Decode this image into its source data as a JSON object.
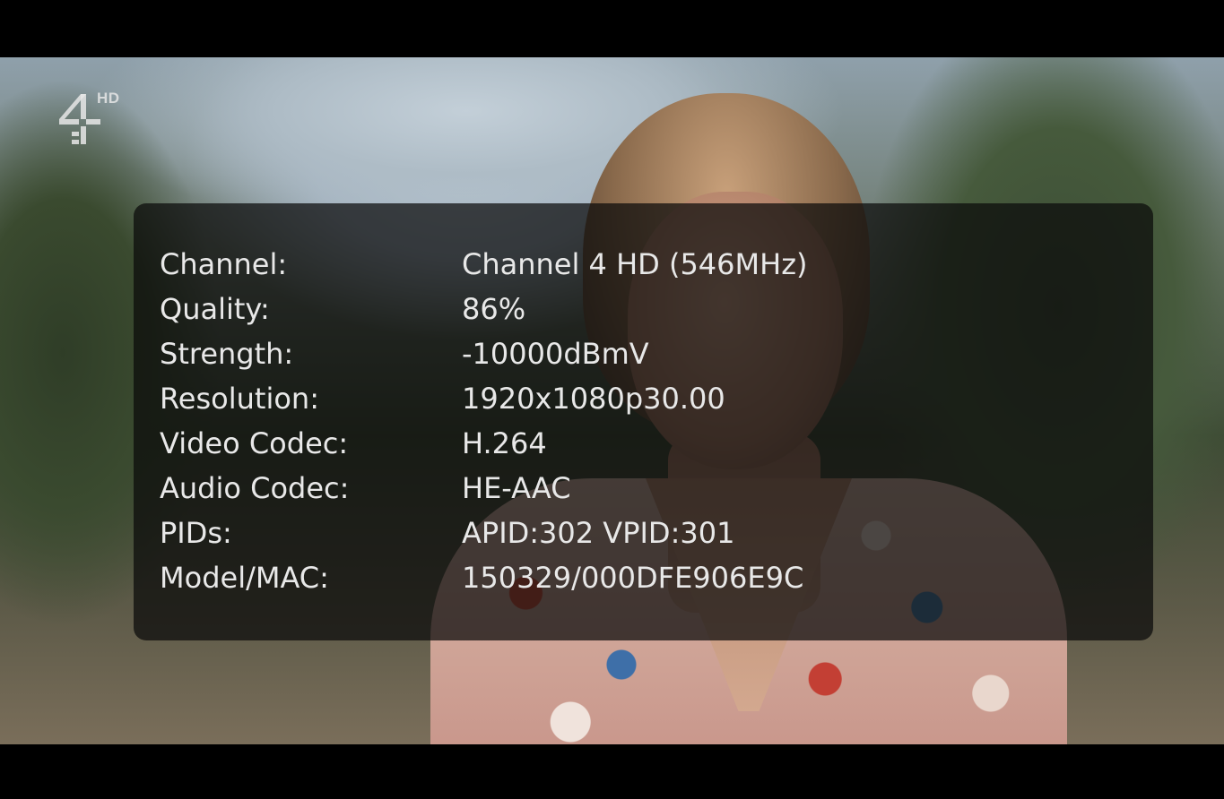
{
  "logo": {
    "icon": "channel-4-logo-icon",
    "badge": "HD"
  },
  "info": {
    "rows": [
      {
        "label": "Channel:",
        "value": "Channel 4 HD (546MHz)"
      },
      {
        "label": "Quality:",
        "value": "86%"
      },
      {
        "label": "Strength:",
        "value": "-10000dBmV"
      },
      {
        "label": "Resolution:",
        "value": "1920x1080p30.00"
      },
      {
        "label": "Video Codec:",
        "value": "H.264"
      },
      {
        "label": "Audio Codec:",
        "value": "HE-AAC"
      },
      {
        "label": "PIDs:",
        "value": "APID:302 VPID:301"
      },
      {
        "label": "Model/MAC:",
        "value": "150329/000DFE906E9C"
      }
    ]
  }
}
